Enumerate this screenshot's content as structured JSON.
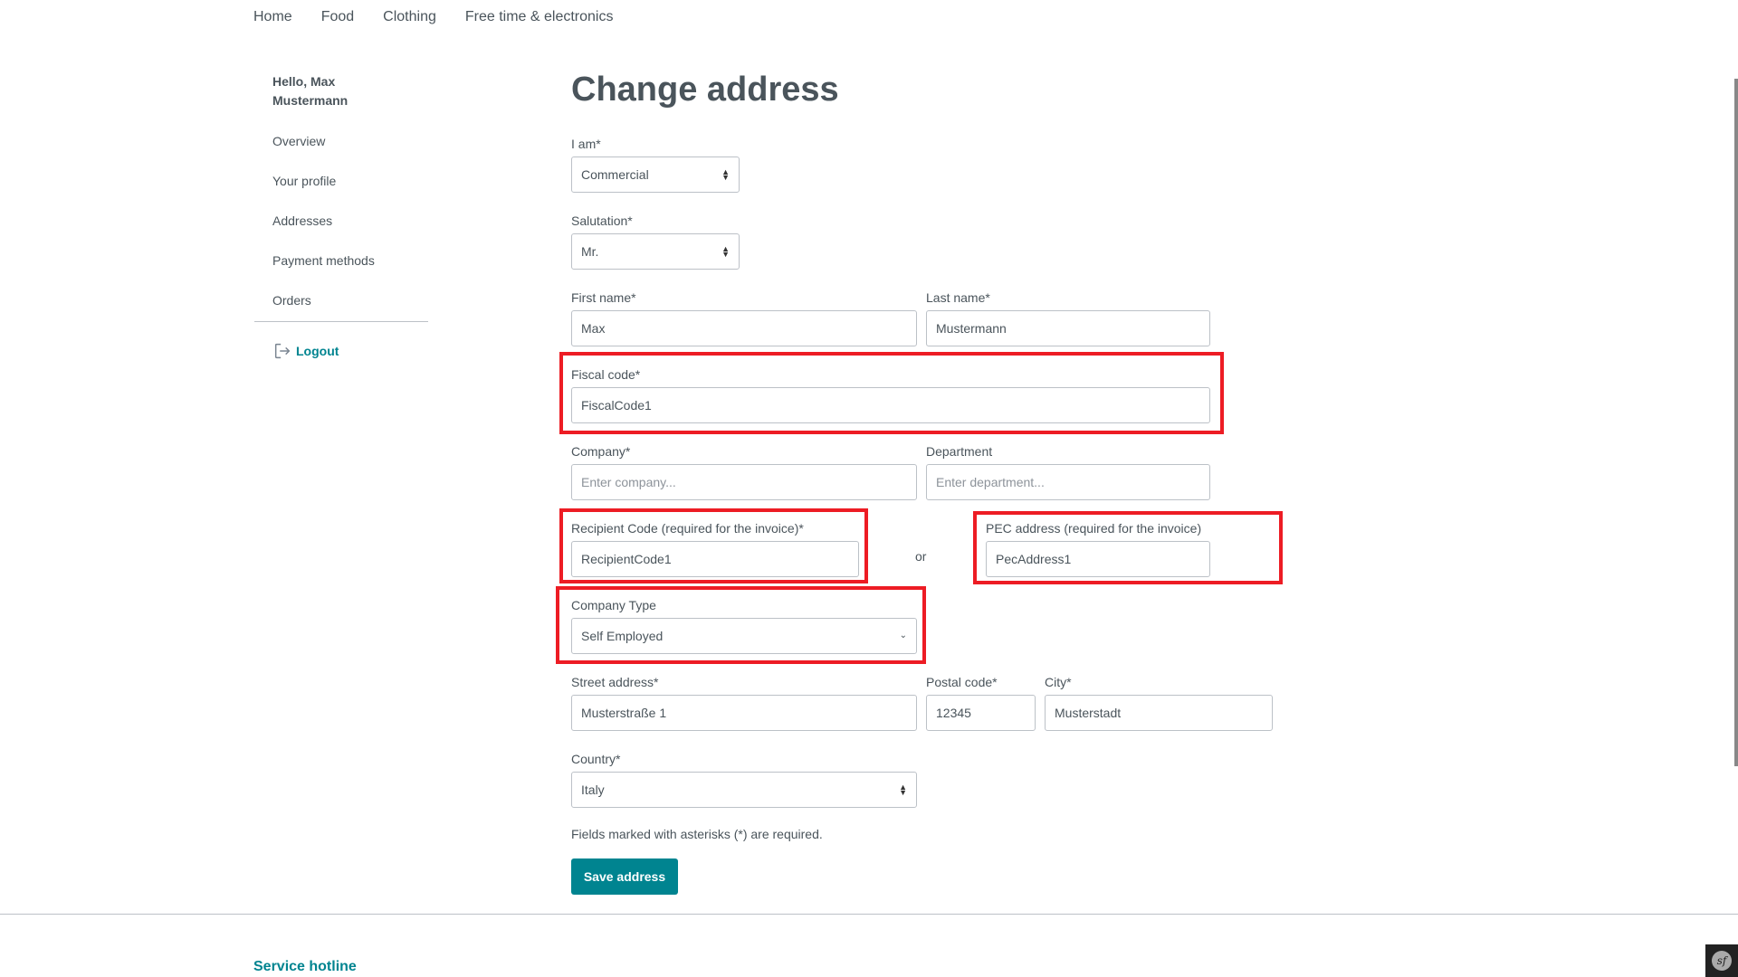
{
  "nav": {
    "items": [
      "Home",
      "Food",
      "Clothing",
      "Free time & electronics"
    ]
  },
  "sidebar": {
    "greeting": "Hello, Max Mustermann",
    "items": [
      "Overview",
      "Your profile",
      "Addresses",
      "Payment methods",
      "Orders"
    ],
    "logout_label": "Logout"
  },
  "page": {
    "title": "Change address"
  },
  "form": {
    "account_type": {
      "label": "I am*",
      "value": "Commercial"
    },
    "salutation": {
      "label": "Salutation*",
      "value": "Mr."
    },
    "first_name": {
      "label": "First name*",
      "value": "Max"
    },
    "last_name": {
      "label": "Last name*",
      "value": "Mustermann"
    },
    "fiscal_code": {
      "label": "Fiscal code*",
      "value": "FiscalCode1"
    },
    "company": {
      "label": "Company*",
      "placeholder": "Enter company..."
    },
    "department": {
      "label": "Department",
      "placeholder": "Enter department..."
    },
    "recipient_code": {
      "label": "Recipient Code (required for the invoice)*",
      "value": "RecipientCode1"
    },
    "or_text": "or",
    "pec_address": {
      "label": "PEC address (required for the invoice)",
      "value": "PecAddress1"
    },
    "company_type": {
      "label": "Company Type",
      "value": "Self Employed"
    },
    "street": {
      "label": "Street address*",
      "value": "Musterstraße 1"
    },
    "postal_code": {
      "label": "Postal code*",
      "value": "12345"
    },
    "city": {
      "label": "City*",
      "value": "Musterstadt"
    },
    "country": {
      "label": "Country*",
      "value": "Italy"
    },
    "required_note": "Fields marked with asterisks (*) are required.",
    "save_label": "Save address"
  },
  "footer": {
    "hotline_title": "Service hotline"
  },
  "colors": {
    "accent": "#008490",
    "highlight": "#ed1c24",
    "text": "#4a545b"
  }
}
